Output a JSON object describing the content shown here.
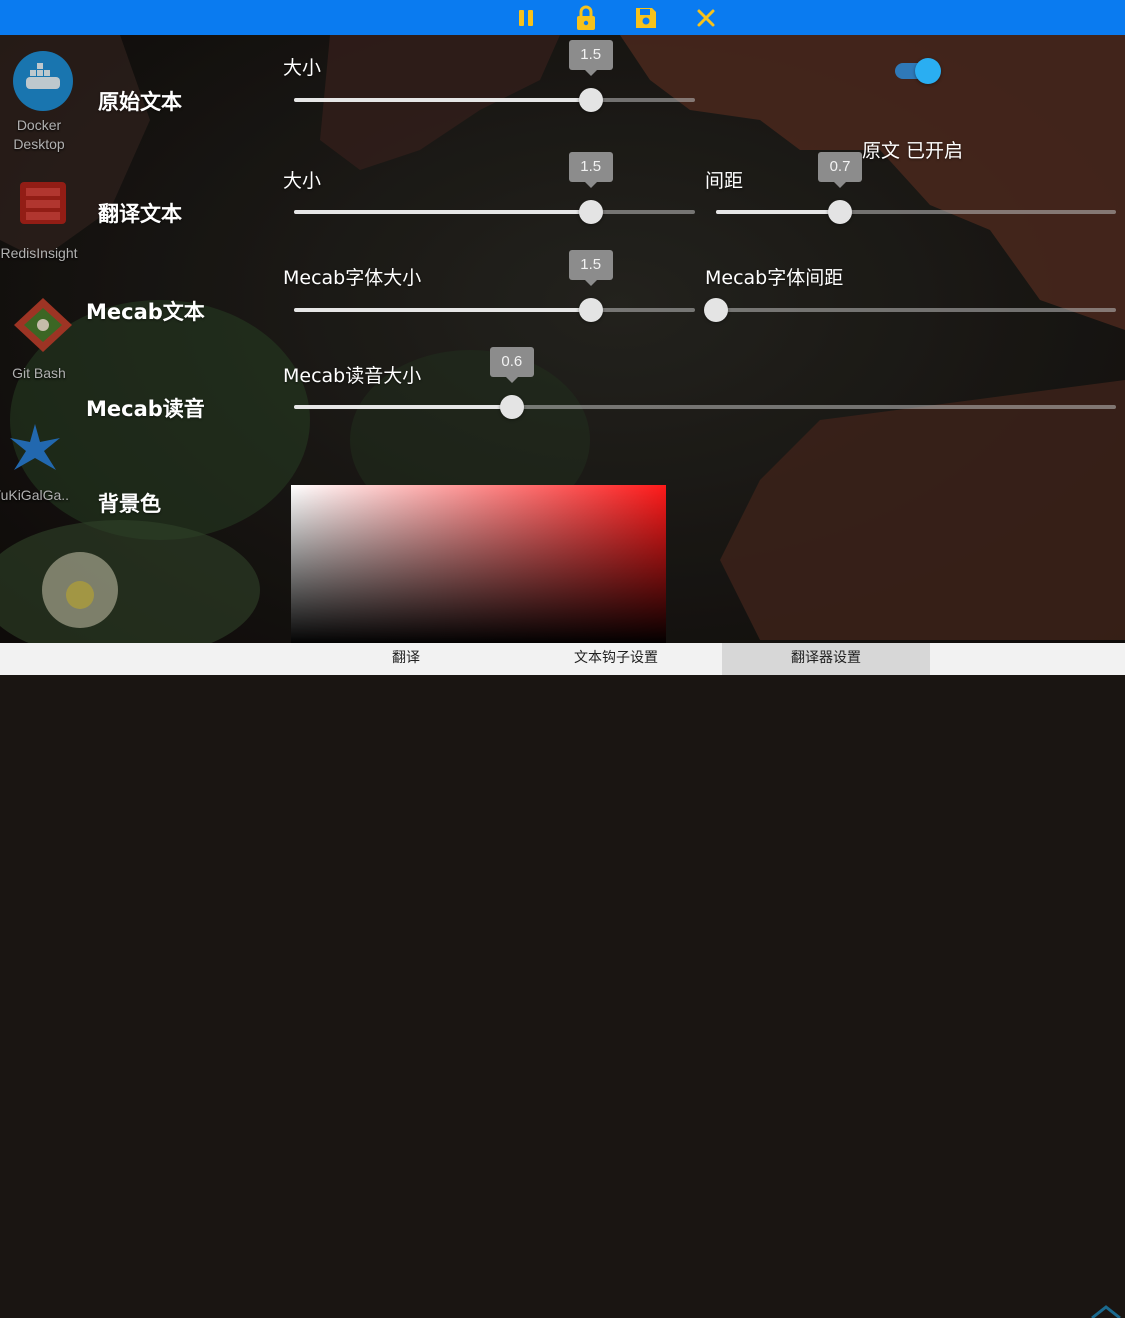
{
  "toolbar": {
    "buttons": [
      {
        "name": "pause-icon",
        "color": "#f7c21b"
      },
      {
        "name": "lock-icon",
        "color": "#f7c21b"
      },
      {
        "name": "save-icon",
        "color": "#f7c21b"
      },
      {
        "name": "close-icon",
        "color": "#f7c21b"
      }
    ],
    "background": "#0a7bf0"
  },
  "desktop": {
    "icons": [
      {
        "label_line1": "Docker",
        "label_line2": "Desktop"
      },
      {
        "label_line1": "RedisInsight",
        "label_line2": ""
      },
      {
        "label_line1": "Git Bash",
        "label_line2": ""
      },
      {
        "label_line1": "YuKiGalGa...",
        "label_line2": ""
      }
    ]
  },
  "settings": {
    "original": {
      "label": "原始文本",
      "size_label": "大小",
      "size_value": "1.5",
      "size_fraction": 0.74,
      "toggle_on": true,
      "status_text": "原文 已开启"
    },
    "translated": {
      "label": "翻译文本",
      "size_label": "大小",
      "size_value": "1.5",
      "size_fraction": 0.74,
      "spacing_label": "间距",
      "spacing_value": "0.7",
      "spacing_fraction": 0.31
    },
    "mecab": {
      "label": "Mecab文本",
      "font_size_label": "Mecab字体大小",
      "font_size_value": "1.5",
      "font_size_fraction": 0.74,
      "spacing_label": "Mecab字体间距",
      "spacing_fraction": 0.0
    },
    "mecab_reading": {
      "label": "Mecab读音",
      "size_label": "Mecab读音大小",
      "size_value": "0.6",
      "size_fraction": 0.265
    },
    "background_color": {
      "label": "背景色",
      "hue": "#ff1a1a"
    }
  },
  "tabs": [
    {
      "label": "翻译",
      "active": false
    },
    {
      "label": "文本钩子设置",
      "active": false
    },
    {
      "label": "翻译器设置",
      "active": true
    }
  ]
}
